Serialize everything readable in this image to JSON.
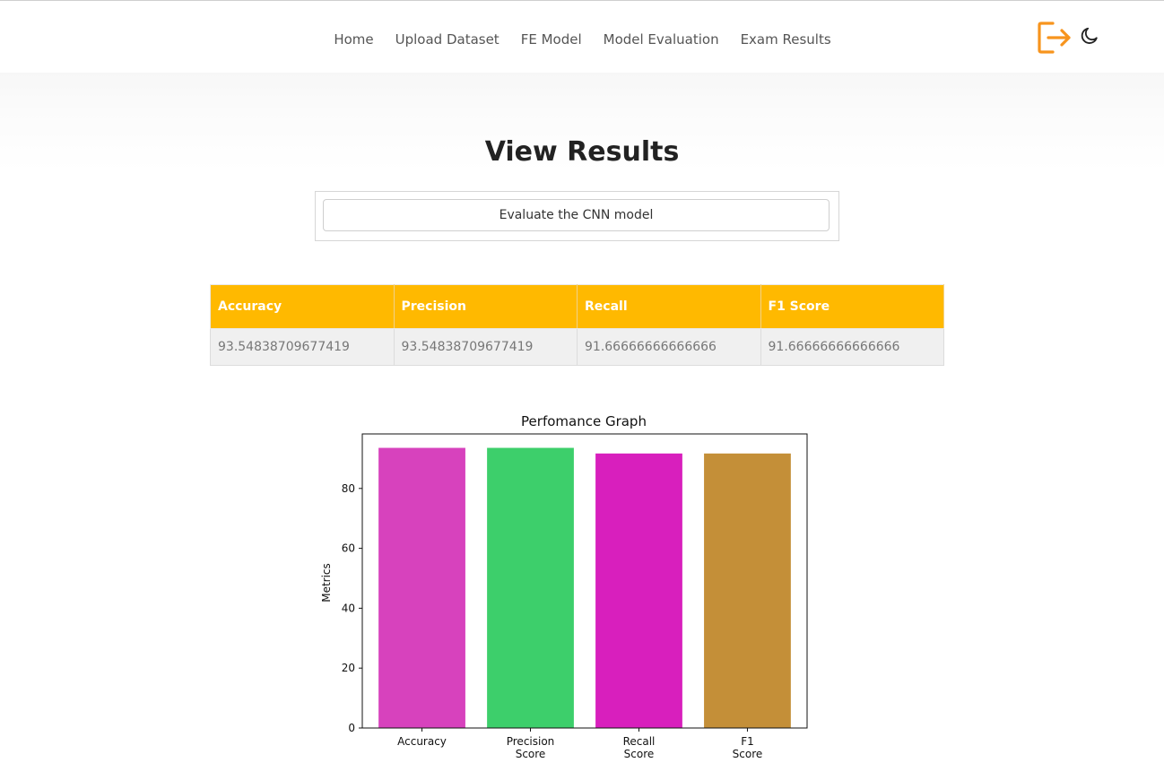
{
  "nav": {
    "items": [
      {
        "label": "Home"
      },
      {
        "label": "Upload Dataset"
      },
      {
        "label": "FE Model"
      },
      {
        "label": "Model Evaluation"
      },
      {
        "label": "Exam Results"
      }
    ],
    "icons": [
      "logout-icon",
      "moon-icon"
    ],
    "accent": "#f7941d"
  },
  "page": {
    "title": "View Results",
    "evaluate_button": "Evaluate the CNN model"
  },
  "metrics_table": {
    "header_color": "#ffb900",
    "headers": [
      "Accuracy",
      "Precision",
      "Recall",
      "F1 Score"
    ],
    "rows": [
      [
        "93.54838709677419",
        "93.54838709677419",
        "91.66666666666666",
        "91.66666666666666"
      ]
    ]
  },
  "chart_data": {
    "type": "bar",
    "title": "Perfomance Graph",
    "xlabel": "",
    "ylabel": "Metrics",
    "categories": [
      "Accuracy",
      "Precision Score",
      "Recall Score",
      "F1 Score"
    ],
    "category_label_lines": [
      [
        "Accuracy"
      ],
      [
        "Precision",
        "Score"
      ],
      [
        "Recall",
        "Score"
      ],
      [
        "F1",
        "Score"
      ]
    ],
    "values": [
      93.55,
      93.55,
      91.67,
      91.67
    ],
    "colors": [
      "#d742bd",
      "#3dcf6b",
      "#d81fbd",
      "#c48f38"
    ],
    "ylim": [
      0,
      98.2
    ],
    "yticks": [
      0,
      20,
      40,
      60,
      80
    ],
    "grid": false
  }
}
